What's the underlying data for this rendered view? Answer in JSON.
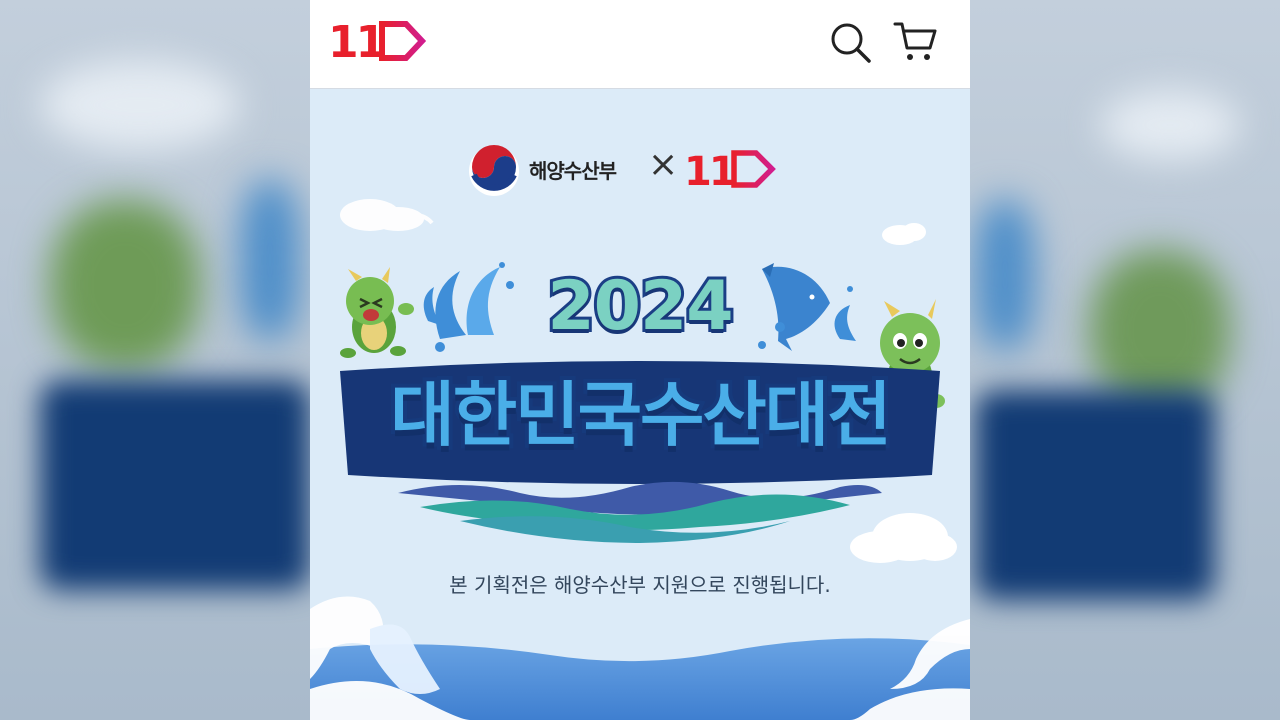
{
  "header": {
    "logo_text": "11",
    "search_icon": "search-icon",
    "cart_icon": "cart-icon"
  },
  "banner": {
    "ministry_name": "해양수산부",
    "collab_mark": "×",
    "partner_logo_text": "11",
    "event_year": "2024",
    "event_title": "대한민국수산대전",
    "notice": "본 기획전은 해양수산부 지원으로 진행됩니다."
  },
  "colors": {
    "brand": "#e0202f",
    "brand_accent": "#d6208a",
    "title_fill": "#4aaee8",
    "title_outline": "#163a7c",
    "year_fill": "#7bd1c2",
    "panel_bg": "#dcebf8"
  }
}
